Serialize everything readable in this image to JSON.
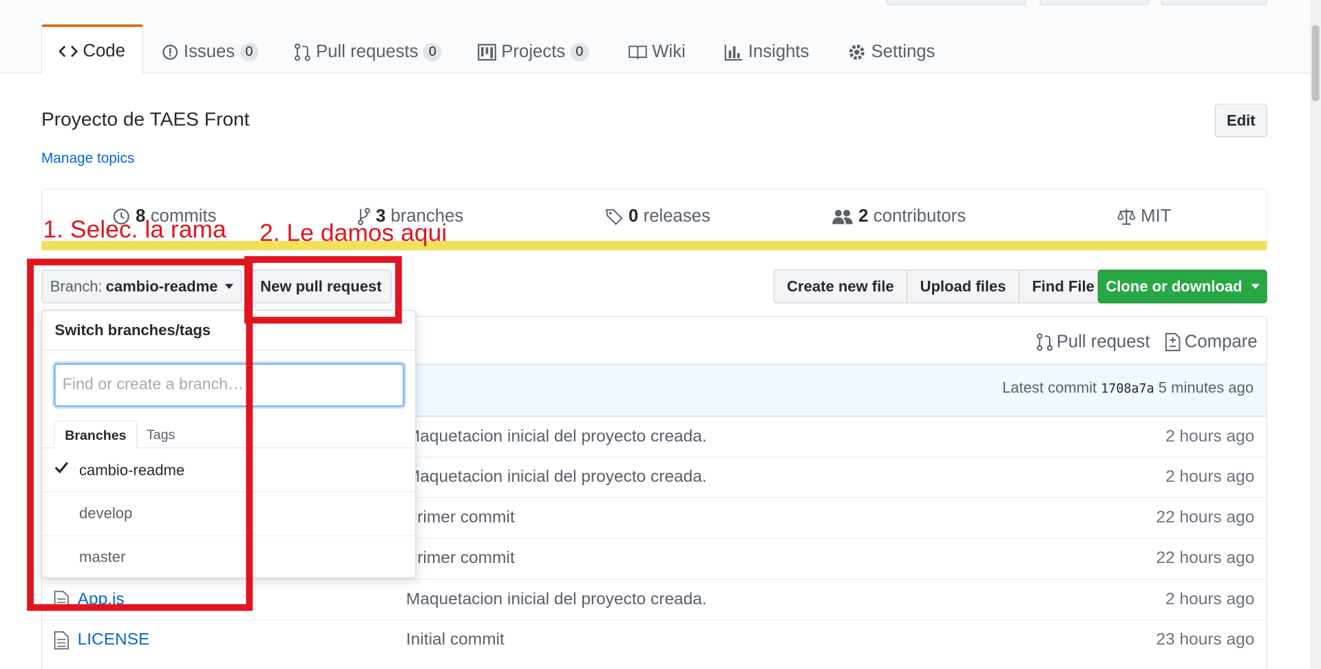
{
  "tabs": [
    {
      "label": "Code",
      "icon": "code-icon"
    },
    {
      "label": "Issues",
      "count": "0",
      "icon": "issue-opened-icon"
    },
    {
      "label": "Pull requests",
      "count": "0",
      "icon": "git-pull-request-icon"
    },
    {
      "label": "Projects",
      "count": "0",
      "icon": "project-icon"
    },
    {
      "label": "Wiki",
      "icon": "book-icon"
    },
    {
      "label": "Insights",
      "icon": "graph-icon"
    },
    {
      "label": "Settings",
      "icon": "gear-icon"
    }
  ],
  "repo": {
    "description": "Proyecto de TAES Front",
    "manage_topics": "Manage topics",
    "edit_label": "Edit"
  },
  "summary": {
    "commits_count": "8",
    "commits_label": "commits",
    "branches_count": "3",
    "branches_label": "branches",
    "releases_count": "0",
    "releases_label": "releases",
    "contributors_count": "2",
    "contributors_label": "contributors",
    "license": "MIT"
  },
  "language_bar_color": "#f1e05a",
  "toolbar": {
    "branch_prefix": "Branch:",
    "branch_name": "cambio-readme",
    "new_pull_request": "New pull request",
    "create_new_file": "Create new file",
    "upload_files": "Upload files",
    "find_file": "Find File",
    "clone_or_download": "Clone or download"
  },
  "branch_links": {
    "pull_request": "Pull request",
    "compare": "Compare"
  },
  "latest_commit": {
    "label": "Latest commit",
    "sha": "1708a7a",
    "age": "5 minutes ago"
  },
  "files": [
    {
      "name": "",
      "message": "Maquetacion inicial del proyecto creada.",
      "age": "2 hours ago"
    },
    {
      "name": "",
      "message": "Maquetacion inicial del proyecto creada.",
      "age": "2 hours ago"
    },
    {
      "name": "",
      "message": "Primer commit",
      "age": "22 hours ago"
    },
    {
      "name": "",
      "message": "Primer commit",
      "age": "22 hours ago"
    },
    {
      "name": "App.js",
      "message": "Maquetacion inicial del proyecto creada.",
      "age": "2 hours ago"
    },
    {
      "name": "LICENSE",
      "message": "Initial commit",
      "age": "23 hours ago"
    }
  ],
  "branch_dropdown": {
    "title": "Switch branches/tags",
    "filter_placeholder": "Find or create a branch…",
    "tab_branches": "Branches",
    "tab_tags": "Tags",
    "branches": [
      "cambio-readme",
      "develop",
      "master"
    ],
    "selected": "cambio-readme"
  },
  "annotations": {
    "step1": "1. Selec. la rama",
    "step2": "2. Le damos aqui",
    "color": "#e0151f"
  },
  "accent_colors": {
    "selected_tab_border": "#e36209",
    "link": "#0366d6",
    "clone_button": "#28a745"
  }
}
